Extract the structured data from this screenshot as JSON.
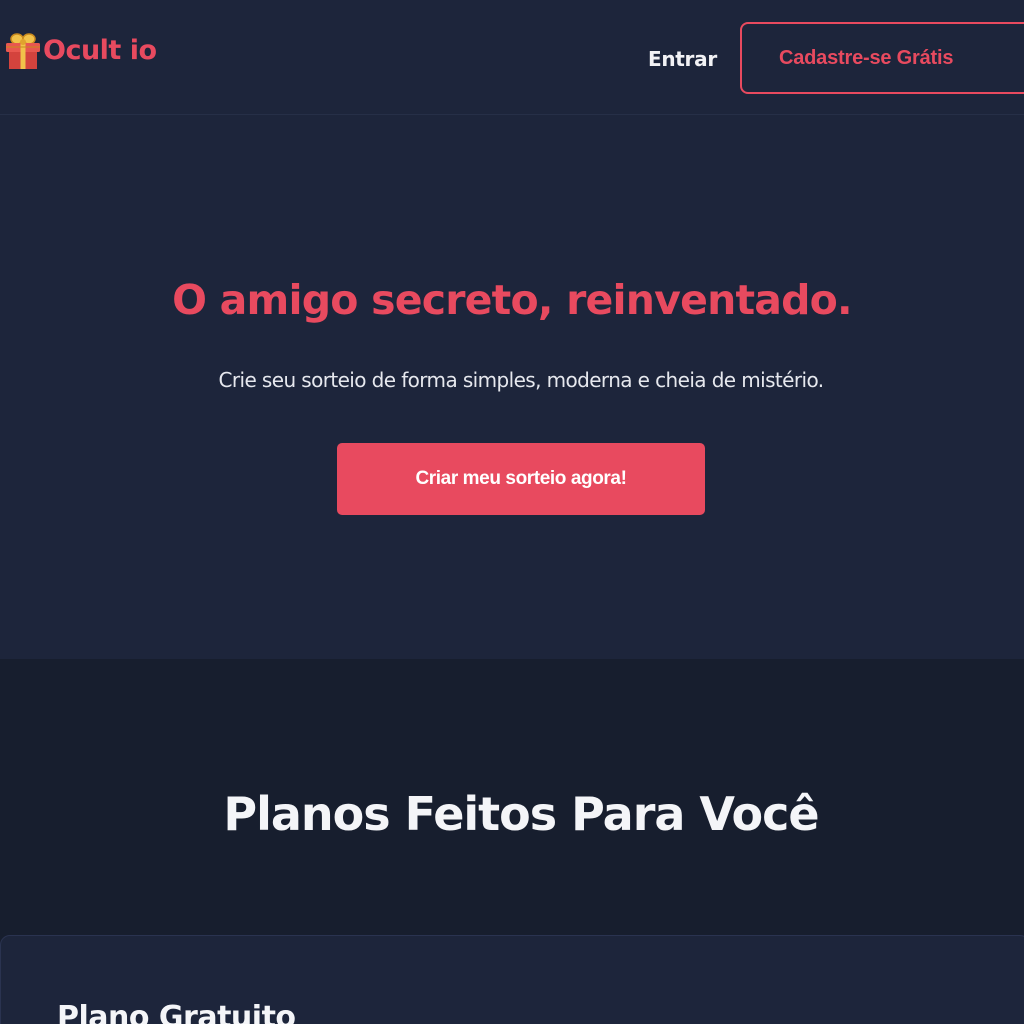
{
  "header": {
    "brand_name": "Ocult io",
    "brand_icon": "gift-icon",
    "login_label": "Entrar",
    "signup_label": "Cadastre-se Grátis"
  },
  "hero": {
    "title": "O amigo secreto, reinventado.",
    "subtitle": "Crie seu sorteio de forma simples, moderna e cheia de mistério.",
    "cta_label": "Criar meu sorteio agora!"
  },
  "plans": {
    "title": "Planos Feitos Para Você",
    "cards": [
      {
        "title": "Plano Gratuito"
      }
    ]
  },
  "colors": {
    "accent": "#e84a5f",
    "background": "#1d253b",
    "section_dark": "#171e2e",
    "text_light": "#f4f5f8"
  }
}
